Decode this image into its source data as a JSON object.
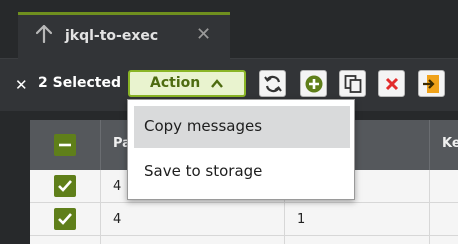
{
  "tab": {
    "title": "jkql-to-exec",
    "icon": "arrow-up-icon",
    "close": "✕"
  },
  "toolbar": {
    "clear_selection": "✕",
    "selected_label": "2 Selected",
    "action_label": "Action",
    "buttons": [
      "refresh-icon",
      "add-icon",
      "copy-icon",
      "delete-icon",
      "import-icon"
    ]
  },
  "table": {
    "headers": [
      "Pa",
      "...",
      "Ke"
    ],
    "rows": [
      {
        "checked": true,
        "col1": "4",
        "col2": ""
      },
      {
        "checked": true,
        "col1": "4",
        "col2": "1"
      }
    ]
  },
  "action_menu": {
    "items": [
      "Copy messages",
      "Save to storage"
    ],
    "highlighted": "Copy messages"
  },
  "colors": {
    "accent": "#6f8f1f",
    "checkbox": "#5f7f1a",
    "delete": "#e22b2b",
    "import": "#f0a21a"
  }
}
